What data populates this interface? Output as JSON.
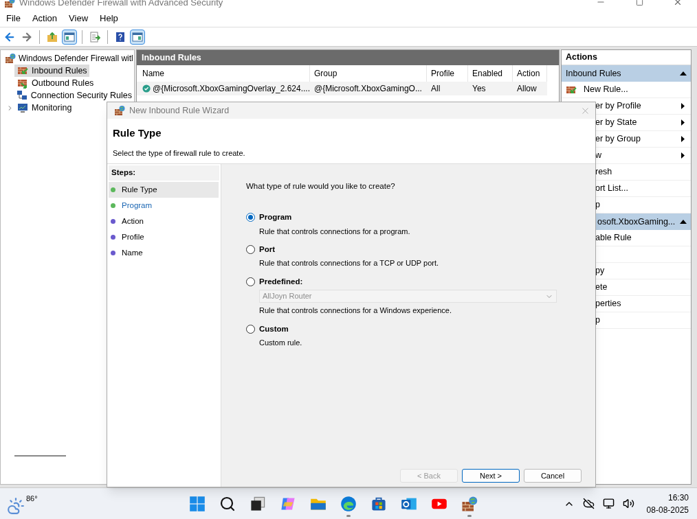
{
  "window": {
    "title": "Windows Defender Firewall with Advanced Security"
  },
  "menu": [
    "File",
    "Action",
    "View",
    "Help"
  ],
  "toolbar": [
    {
      "kind": "back"
    },
    {
      "kind": "forward"
    },
    {
      "kind": "sep"
    },
    {
      "kind": "up"
    },
    {
      "kind": "pane",
      "selected": true
    },
    {
      "kind": "sep"
    },
    {
      "kind": "export"
    },
    {
      "kind": "sep"
    },
    {
      "kind": "help"
    },
    {
      "kind": "pane2",
      "selected": true
    }
  ],
  "tree": {
    "label": "Windows Defender Firewall witl",
    "children": [
      {
        "label": "Inbound Rules",
        "selected": true,
        "expandable": false,
        "kind": "inbound"
      },
      {
        "label": "Outbound Rules",
        "selected": false,
        "expandable": false,
        "kind": "outbound"
      },
      {
        "label": "Connection Security Rules",
        "selected": false,
        "expandable": false,
        "kind": "connection"
      },
      {
        "label": "Monitoring",
        "selected": false,
        "expandable": true,
        "kind": "monitor"
      }
    ]
  },
  "rules_pane": {
    "title": "Inbound Rules",
    "columns": [
      "Name",
      "Group",
      "Profile",
      "Enabled",
      "Action"
    ],
    "rows": [
      {
        "cells": [
          "@{Microsoft.XboxGamingOverlay_2.624....",
          "@{Microsoft.XboxGamingO...",
          "All",
          "Yes",
          "Allow"
        ],
        "enabled": true
      }
    ]
  },
  "actions": {
    "title": "Actions",
    "sections": [
      {
        "title": "Inbound Rules",
        "expanded": true,
        "items": [
          {
            "label": "New Rule...",
            "kind": "icon"
          },
          {
            "label": "er by Profile",
            "kind": "submenu"
          },
          {
            "label": "er by State",
            "kind": "submenu"
          },
          {
            "label": "er by Group",
            "kind": "submenu"
          },
          {
            "label": "w",
            "kind": "submenu"
          },
          {
            "label": "resh",
            "kind": "plain"
          },
          {
            "label": "ort List...",
            "kind": "plain"
          },
          {
            "label": "p",
            "kind": "plain"
          }
        ]
      },
      {
        "title": "osoft.XboxGaming...",
        "expanded": true,
        "items": [
          {
            "label": "able Rule",
            "kind": "plain"
          },
          {
            "kind": "blank"
          },
          {
            "label": "py",
            "kind": "plain"
          },
          {
            "label": "ete",
            "kind": "plain"
          },
          {
            "label": "perties",
            "kind": "plain"
          },
          {
            "label": "p",
            "kind": "plain"
          }
        ]
      }
    ]
  },
  "wizard": {
    "title": "New Inbound Rule Wizard",
    "heading": "Rule Type",
    "subtitle": "Select the type of firewall rule to create.",
    "steps_title": "Steps:",
    "steps": [
      {
        "label": "Rule Type",
        "selected": true,
        "highlighted": false,
        "color": "#5cb85c"
      },
      {
        "label": "Program",
        "selected": false,
        "highlighted": true,
        "color": "#5cb85c"
      },
      {
        "label": "Action",
        "selected": false,
        "highlighted": false,
        "color": "#6a5acd"
      },
      {
        "label": "Profile",
        "selected": false,
        "highlighted": false,
        "color": "#6a5acd"
      },
      {
        "label": "Name",
        "selected": false,
        "highlighted": false,
        "color": "#6a5acd"
      }
    ],
    "question": "What type of rule would you like to create?",
    "options": [
      {
        "label": "Program",
        "description": "Rule that controls connections for a program.",
        "selected": true,
        "kind": "plain"
      },
      {
        "label": "Port",
        "description": "Rule that controls connections for a TCP or UDP port.",
        "selected": false,
        "kind": "plain"
      },
      {
        "label": "Predefined:",
        "description": "Rule that controls connections for a Windows experience.",
        "selected": false,
        "kind": "dropdown",
        "dropdown": {
          "value": "AllJoyn Router",
          "disabled": true
        }
      },
      {
        "label": "Custom",
        "description": "Custom rule.",
        "selected": false,
        "kind": "plain"
      }
    ],
    "buttons": [
      {
        "label": "< Back",
        "disabled": true,
        "default": false
      },
      {
        "label": "Next >",
        "disabled": false,
        "default": true
      },
      {
        "label": "Cancel",
        "disabled": false,
        "default": false
      }
    ]
  },
  "taskbar": {
    "weather": "86°",
    "apps": [
      {
        "kind": "start",
        "running": false
      },
      {
        "kind": "search",
        "running": false
      },
      {
        "kind": "taskview",
        "running": false
      },
      {
        "kind": "copilot",
        "running": false
      },
      {
        "kind": "folder",
        "running": false
      },
      {
        "kind": "edge",
        "running": true
      },
      {
        "kind": "store",
        "running": false
      },
      {
        "kind": "outlook",
        "running": false
      },
      {
        "kind": "youtube",
        "running": false
      },
      {
        "kind": "firewall",
        "running": true
      }
    ],
    "time": "16:30",
    "date": "08-08-2025"
  }
}
